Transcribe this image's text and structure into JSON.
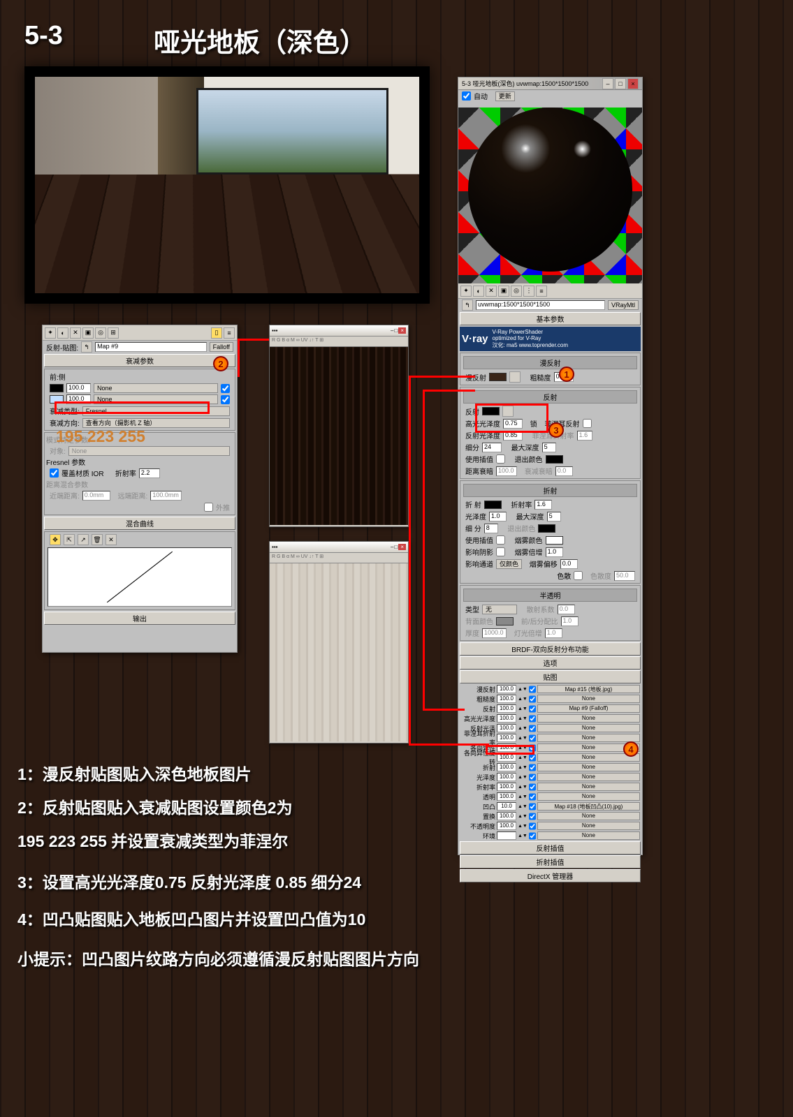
{
  "header": {
    "num": "5-3",
    "title": "哑光地板（深色）"
  },
  "matpanel": {
    "titlebar": "5-3    哑光地板(深色)    uvwmap:1500*1500*1500",
    "auto": "自动",
    "update": "更新",
    "objrow": "uvwmap:1500*1500*1500",
    "mtl": "VRayMtl",
    "section_basic": "基本参数",
    "vray": {
      "brand": "V·ray",
      "sub": "V-Ray PowerShader",
      "opt": "optimized for V-Ray",
      "cred": "汉化: ma5 www.toprender.com"
    },
    "diffuse": {
      "hd": "漫反射",
      "lbl": "漫反射",
      "rough": "粗糙度",
      "rv": "0.0"
    },
    "reflect": {
      "hd": "反射",
      "lbl": "反射",
      "hg": "高光光泽度",
      "hgv": "0.75",
      "rg": "反射光泽度",
      "rgv": "0.85",
      "sub": "细分",
      "subv": "24",
      "interp": "使用插值",
      "dim": "距离衰暗",
      "dimv": "100.0",
      "lock": "锁",
      "fres": "菲涅耳反射",
      "ior": "菲涅耳折射率",
      "iorv": "1.6",
      "maxd": "最大深度",
      "maxdv": "5",
      "exit": "退出颜色",
      "dimf": "衰减衰暗",
      "dimfv": "0.0"
    },
    "refract": {
      "hd": "折射",
      "lbl": "折 射",
      "gloss": "光泽度",
      "glossv": "1.0",
      "sub": "细 分",
      "subv": "8",
      "interp": "使用插值",
      "shadow": "影响阴影",
      "chan": "影响通道",
      "chanv": "仅颜色",
      "ior": "折射率",
      "iorv": "1.6",
      "maxd": "最大深度",
      "maxdv": "5",
      "exit": "退出颜色",
      "fogc": "烟雾颜色",
      "fogm": "烟雾倍增",
      "fogmv": "1.0",
      "fogb": "烟雾偏移",
      "fogbv": "0.0",
      "disp": "色散",
      "abbe": "色散度",
      "abbev": "50.0"
    },
    "trans": {
      "hd": "半透明",
      "type": "类型",
      "typev": "无",
      "back": "背面颜色",
      "thick": "厚度",
      "thickv": "1000.0",
      "scat": "散射系数",
      "scatv": "0.0",
      "fb": "前/后分配比",
      "fbv": "1.0",
      "lm": "灯光倍增",
      "lmv": "1.0"
    },
    "brdf_bar": "BRDF-双向反射分布功能",
    "opts_bar": "选项",
    "maps_bar": "贴图",
    "maps": [
      {
        "n": "漫反射",
        "v": "100.0",
        "on": true,
        "m": "Map #15 (地板.jpg)"
      },
      {
        "n": "粗糙度",
        "v": "100.0",
        "on": true,
        "m": "None"
      },
      {
        "n": "反射",
        "v": "100.0",
        "on": true,
        "m": "Map #9 (Falloff)"
      },
      {
        "n": "高光光泽度",
        "v": "100.0",
        "on": true,
        "m": "None"
      },
      {
        "n": "反射光泽",
        "v": "100.0",
        "on": true,
        "m": "None"
      },
      {
        "n": "菲涅耳折射率",
        "v": "100.0",
        "on": true,
        "m": "None"
      },
      {
        "n": "各向异性",
        "v": "100.0",
        "on": true,
        "m": "None"
      },
      {
        "n": "各向异性旋转",
        "v": "100.0",
        "on": true,
        "m": "None"
      },
      {
        "n": "折射",
        "v": "100.0",
        "on": true,
        "m": "None"
      },
      {
        "n": "光泽度",
        "v": "100.0",
        "on": true,
        "m": "None"
      },
      {
        "n": "折射率",
        "v": "100.0",
        "on": true,
        "m": "None"
      },
      {
        "n": "透明",
        "v": "100.0",
        "on": true,
        "m": "None"
      },
      {
        "n": "凹凸",
        "v": "10.0",
        "on": true,
        "m": "Map #18 (地板凹凸(10).jpg)"
      },
      {
        "n": "置换",
        "v": "100.0",
        "on": true,
        "m": "None"
      },
      {
        "n": "不透明度",
        "v": "100.0",
        "on": true,
        "m": "None"
      },
      {
        "n": "环境",
        "v": "",
        "on": true,
        "m": "None"
      }
    ],
    "refl_interp": "反射插值",
    "refr_interp": "折射插值",
    "dx": "DirectX 管理器"
  },
  "falloff": {
    "rowlbl": "反射-贴图:",
    "mapname": "Map #9",
    "maptype": "Falloff",
    "sec": "衰减参数",
    "front": "前:侧",
    "v1": "100.0",
    "v2": "100.0",
    "none": "None",
    "type": "衰减类型:",
    "typev": "Fresnel",
    "dir": "衰减方向:",
    "dirv": "查看方向（摄影机 Z 轴）",
    "mode": "模式特定参数:",
    "obj": "对象:",
    "objv": "None",
    "fresnel": "Fresnel 参数",
    "override": "覆盖材质 IOR",
    "iorlbl": "折射率",
    "iorv": "2.2",
    "dist": "距离混合参数",
    "near": "近端距离:",
    "nearv": "0.0mm",
    "far": "远端距离:",
    "farv": "100.0mm",
    "ext": "外推",
    "curve": "混合曲线",
    "output": "输出"
  },
  "rgb": "195  223  255",
  "inst1": "1：漫反射贴图贴入深色地板图片",
  "inst2": "2：反射贴图贴入衰减贴图设置颜色2为",
  "inst3": "195 223 255 并设置衰减类型为菲涅尔",
  "inst4": "3：设置高光光泽度0.75 反射光泽度 0.85 细分24",
  "inst5": "4：凹凸贴图贴入地板凹凸图片并设置凹凸值为10",
  "inst6": "小提示：凹凸图片纹路方向必须遵循漫反射贴图图片方向"
}
